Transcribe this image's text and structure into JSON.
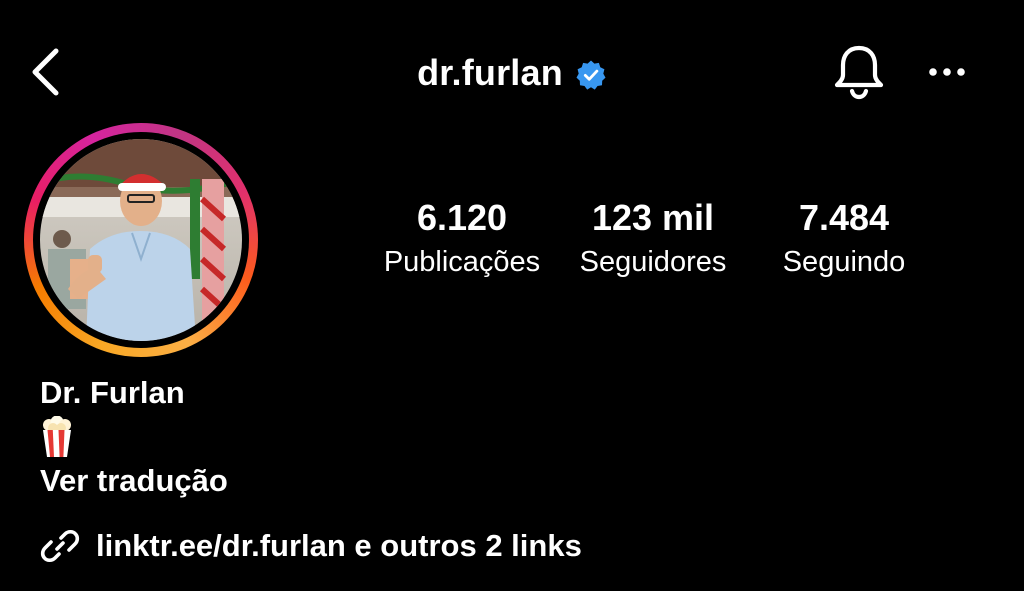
{
  "header": {
    "username": "dr.furlan",
    "verified": true,
    "back_icon": "chevron-left-icon",
    "bell_icon": "bell-icon",
    "more_icon": "ellipsis-icon",
    "accent_verified": "#3897f0"
  },
  "profile": {
    "avatar_alt": "Foto de perfil de dr.furlan",
    "story_ring_colors": [
      "#fcaf45",
      "#e1306c",
      "#c13584"
    ]
  },
  "stats": {
    "posts": {
      "value": "6.120",
      "label": "Publicações"
    },
    "followers": {
      "value": "123 mil",
      "label": "Seguidores"
    },
    "following": {
      "value": "7.484",
      "label": "Seguindo"
    }
  },
  "bio": {
    "name": "Dr. Furlan",
    "emoji": "🍿",
    "translate": "Ver tradução"
  },
  "links": {
    "icon": "link-icon",
    "text": "linktr.ee/dr.furlan e outros 2 links"
  }
}
